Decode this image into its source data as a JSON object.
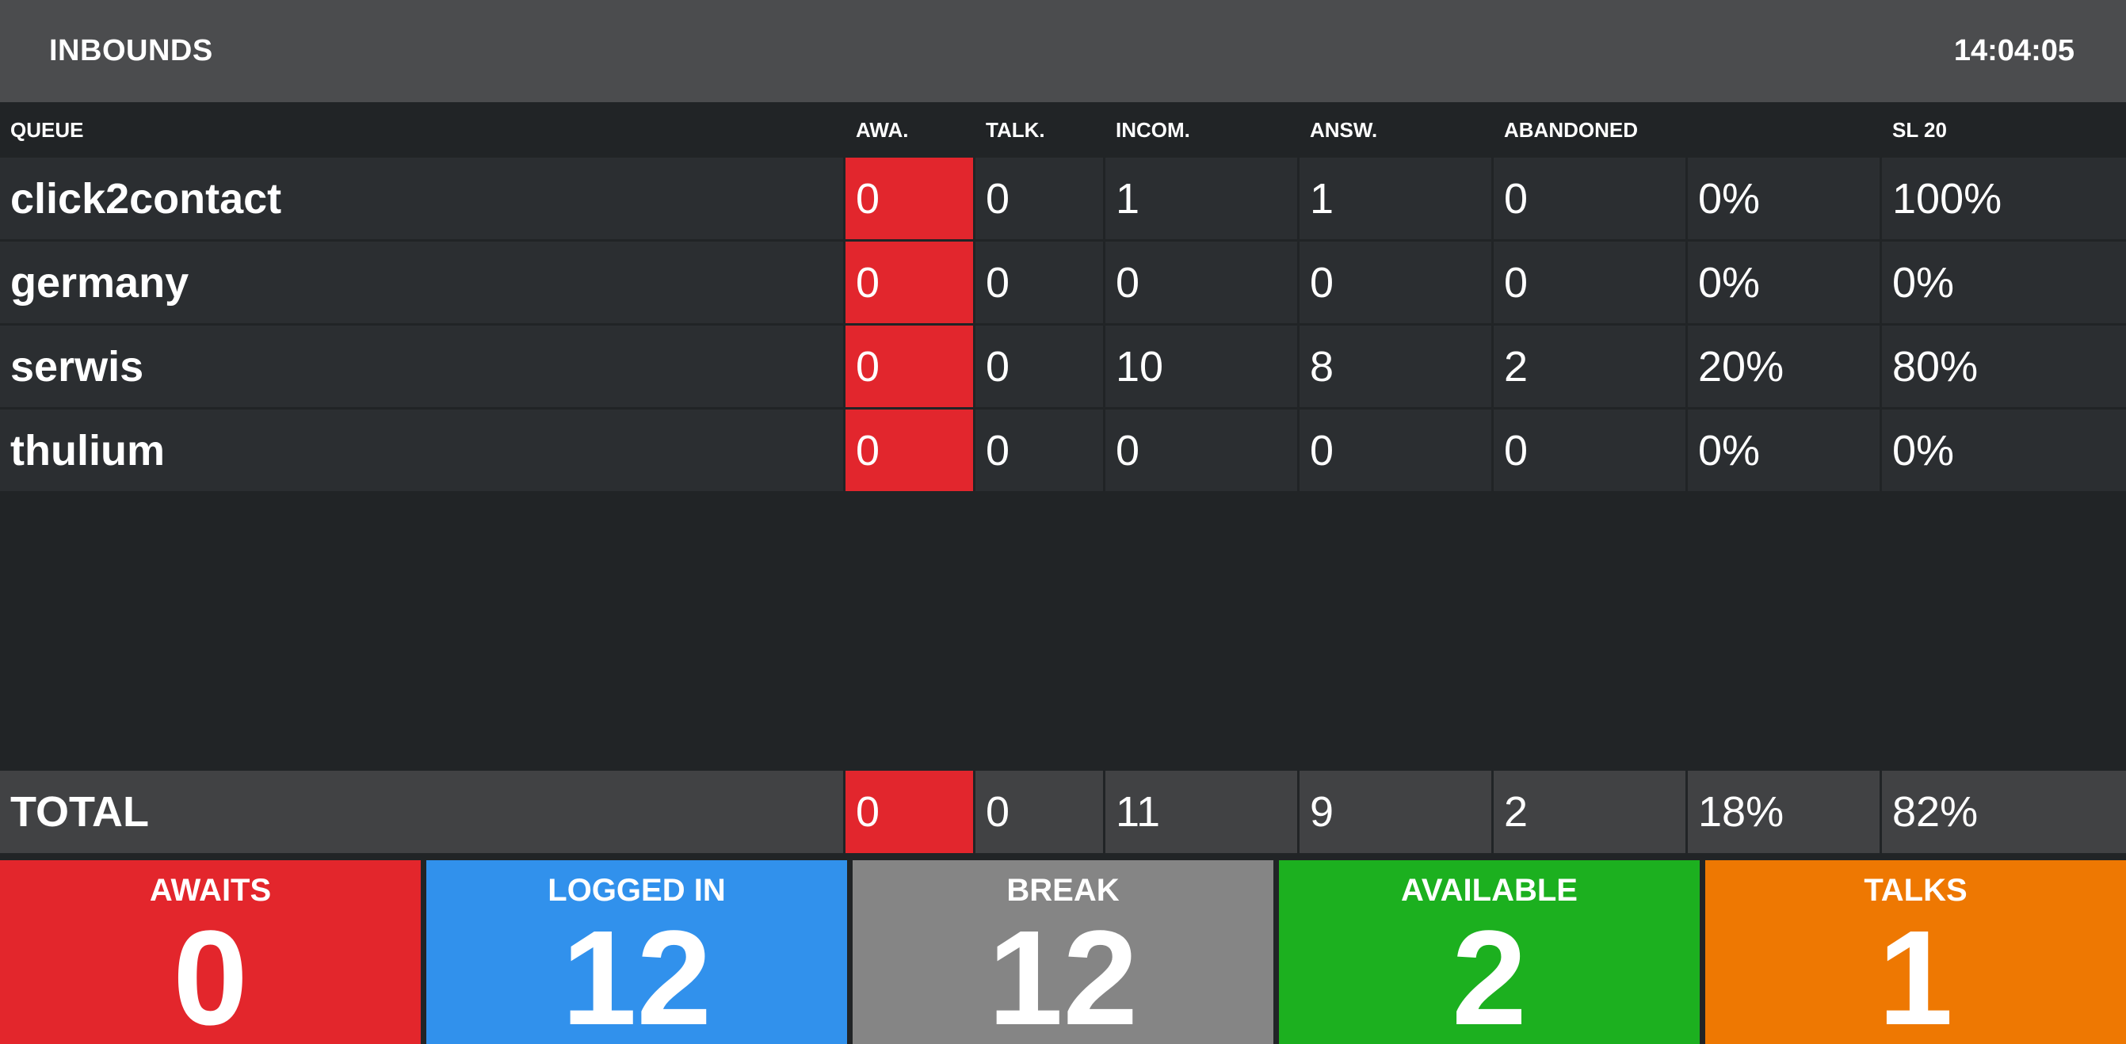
{
  "header": {
    "title": "INBOUNDS",
    "clock": "14:04:05"
  },
  "table": {
    "columns": [
      "QUEUE",
      "AWA.",
      "TALK.",
      "INCOM.",
      "ANSW.",
      "ABANDONED",
      "",
      "SL 20"
    ],
    "rows": [
      {
        "queue": "click2contact",
        "awaiting": "0",
        "talking": "0",
        "incoming": "1",
        "answered": "1",
        "abandoned": "0",
        "abandoned_pct": "0%",
        "sl20": "100%"
      },
      {
        "queue": "germany",
        "awaiting": "0",
        "talking": "0",
        "incoming": "0",
        "answered": "0",
        "abandoned": "0",
        "abandoned_pct": "0%",
        "sl20": "0%"
      },
      {
        "queue": "serwis",
        "awaiting": "0",
        "talking": "0",
        "incoming": "10",
        "answered": "8",
        "abandoned": "2",
        "abandoned_pct": "20%",
        "sl20": "80%"
      },
      {
        "queue": "thulium",
        "awaiting": "0",
        "talking": "0",
        "incoming": "0",
        "answered": "0",
        "abandoned": "0",
        "abandoned_pct": "0%",
        "sl20": "0%"
      }
    ],
    "total": {
      "queue": "TOTAL",
      "awaiting": "0",
      "talking": "0",
      "incoming": "11",
      "answered": "9",
      "abandoned": "2",
      "abandoned_pct": "18%",
      "sl20": "82%"
    }
  },
  "tiles": [
    {
      "label": "AWAITS",
      "value": "0",
      "color": "#e3262c"
    },
    {
      "label": "LOGGED IN",
      "value": "12",
      "color": "#3191ec"
    },
    {
      "label": "BREAK",
      "value": "12",
      "color": "#858585"
    },
    {
      "label": "AVAILABLE",
      "value": "2",
      "color": "#1cb01f"
    },
    {
      "label": "TALKS",
      "value": "1",
      "color": "#ee7802"
    }
  ],
  "colors": {
    "alert": "#e2262d",
    "background": "#212426",
    "header": "#4b4c4e"
  }
}
